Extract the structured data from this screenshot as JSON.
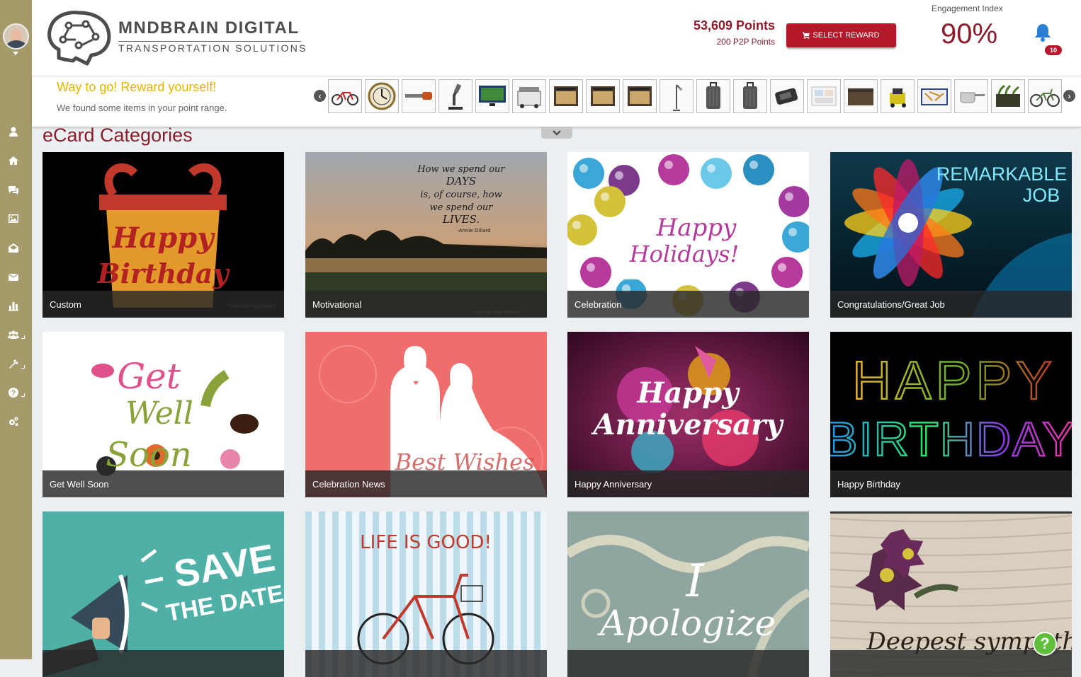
{
  "brand": {
    "title": "MNDBRAIN DIGITAL",
    "subtitle": "TRANSPORTATION SOLUTIONS"
  },
  "header": {
    "points": "53,609 Points",
    "p2p_points": "200 P2P Points",
    "select_reward": "SELECT REWARD",
    "engagement_label": "Engagement Index",
    "engagement_value": "90%",
    "notification_count": "10"
  },
  "sidebar": {
    "items": [
      {
        "name": "profile",
        "icon": "user-icon"
      },
      {
        "name": "home",
        "icon": "home-icon"
      },
      {
        "name": "messages",
        "icon": "chat-icon"
      },
      {
        "name": "gallery",
        "icon": "image-icon"
      },
      {
        "name": "ecards",
        "icon": "envelope-open-icon"
      },
      {
        "name": "mail",
        "icon": "envelope-icon"
      },
      {
        "name": "reports",
        "icon": "bar-chart-icon"
      },
      {
        "name": "team",
        "icon": "users-icon"
      },
      {
        "name": "tools",
        "icon": "tools-icon"
      },
      {
        "name": "help",
        "icon": "question-icon"
      },
      {
        "name": "settings",
        "icon": "gears-icon"
      }
    ]
  },
  "reward_strip": {
    "title": "Way to go! Reward yourself!",
    "subtitle": "We found some items in your point range.",
    "items": [
      "bicycle",
      "wall-clock",
      "hedge-trimmer",
      "microscope",
      "tv",
      "cooler",
      "amplifier",
      "amplifier",
      "amplifier",
      "floor-lamp",
      "suitcase",
      "suitcase",
      "vacuum",
      "photo-frame",
      "storage-box",
      "pressure-washer",
      "tool-set",
      "saucepan",
      "planter",
      "cruiser-bike"
    ]
  },
  "section": {
    "title": "eCard Categories"
  },
  "cards": [
    {
      "label": "Custom",
      "theme": "custom"
    },
    {
      "label": "Motivational",
      "theme": "motivational"
    },
    {
      "label": "Celebration",
      "theme": "celebration"
    },
    {
      "label": "Congratulations/Great Job",
      "theme": "congrats"
    },
    {
      "label": "Get Well Soon",
      "theme": "getwell"
    },
    {
      "label": "Celebration News",
      "theme": "news"
    },
    {
      "label": "Happy Anniversary",
      "theme": "anniversary"
    },
    {
      "label": "Happy Birthday",
      "theme": "birthday"
    },
    {
      "label": "",
      "theme": "savedate"
    },
    {
      "label": "",
      "theme": "lifegood"
    },
    {
      "label": "",
      "theme": "apologize"
    },
    {
      "label": "",
      "theme": "sympathy"
    }
  ],
  "card_art_text": {
    "custom": "Happy Birthday",
    "custom_corner": "MERCURY INSURANCE",
    "motivational_quote": [
      "How we spend our",
      "DAYS",
      "is, of course, how",
      "we spend our",
      "LIVES."
    ],
    "motivational_author": "-Annie Dillard",
    "motivational_credit": "Photo By: Evan Eubanks",
    "celebration": [
      "Happy",
      "Holidays!"
    ],
    "congrats": [
      "REMARKABLE",
      "JOB"
    ],
    "getwell": [
      "Get",
      "Well",
      "Soon"
    ],
    "news": "Best Wishes",
    "anniversary": [
      "Happy",
      "Anniversary"
    ],
    "birthday": [
      "HAPPY",
      "BIRTHDAY"
    ],
    "savedate": [
      "SAVE",
      "THE DATE!"
    ],
    "lifegood": "LIFE IS GOOD!",
    "apologize": [
      "I",
      "Apologize"
    ],
    "sympathy": "Deepest sympathy"
  },
  "help_button": "?"
}
